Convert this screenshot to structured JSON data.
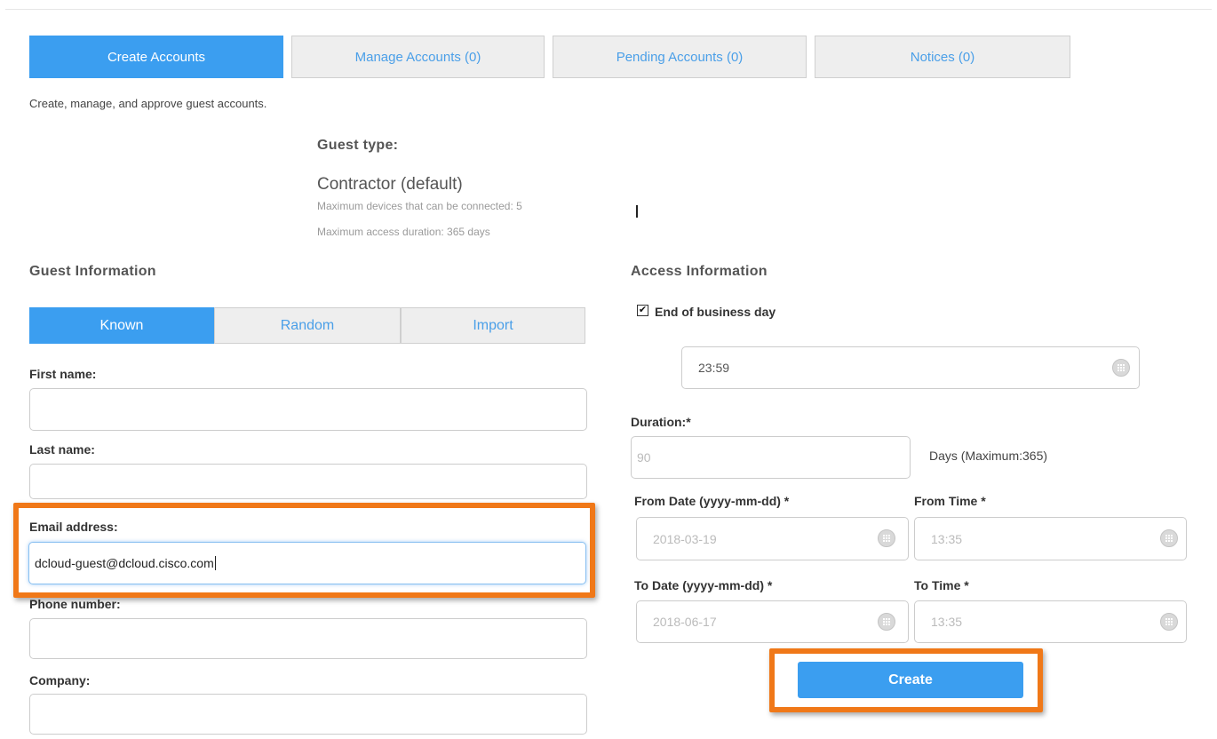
{
  "tabs": [
    {
      "label": "Create Accounts",
      "active": true
    },
    {
      "label": "Manage Accounts (0)",
      "active": false
    },
    {
      "label": "Pending Accounts (0)",
      "active": false
    },
    {
      "label": "Notices (0)",
      "active": false
    }
  ],
  "description": "Create, manage, and approve guest accounts.",
  "guest_type": {
    "heading": "Guest type:",
    "value": "Contractor (default)",
    "max_devices": "Maximum devices that can be connected: 5",
    "max_duration": "Maximum access duration: 365 days"
  },
  "guest_info": {
    "heading": "Guest Information",
    "subtabs": [
      {
        "label": "Known",
        "active": true
      },
      {
        "label": "Random",
        "active": false
      },
      {
        "label": "Import",
        "active": false
      }
    ],
    "fields": {
      "first_name": {
        "label": "First name:",
        "value": ""
      },
      "last_name": {
        "label": "Last name:",
        "value": ""
      },
      "email": {
        "label": "Email address:",
        "value": "dcloud-guest@dcloud.cisco.com"
      },
      "phone": {
        "label": "Phone number:",
        "value": ""
      },
      "company": {
        "label": "Company:",
        "value": ""
      }
    }
  },
  "access_info": {
    "heading": "Access Information",
    "end_of_business_day": {
      "label": "End of business day",
      "checked": true,
      "checkmark": "✔"
    },
    "time_value": "23:59",
    "duration": {
      "label": "Duration:*",
      "placeholder": "90",
      "note": "Days (Maximum:365)"
    },
    "from_date": {
      "label": "From Date (yyyy-mm-dd) *",
      "value": "2018-03-19"
    },
    "from_time": {
      "label": "From Time *",
      "value": "13:35"
    },
    "to_date": {
      "label": "To Date (yyyy-mm-dd) *",
      "value": "2018-06-17"
    },
    "to_time": {
      "label": "To Time *",
      "value": "13:35"
    }
  },
  "create_label": "Create",
  "colors": {
    "accent": "#3b9ef0",
    "highlight": "#f07818"
  },
  "icons": {
    "calendar": "calendar-icon"
  }
}
